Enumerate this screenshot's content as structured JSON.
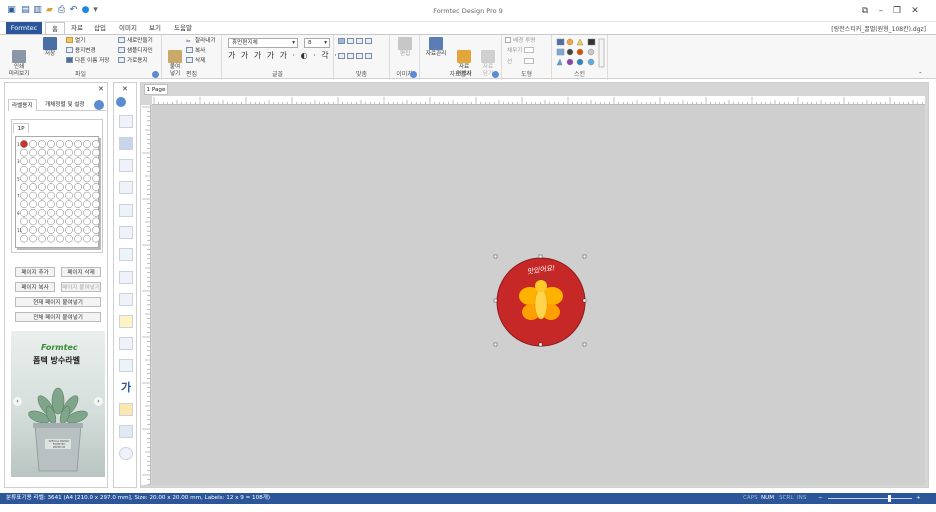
{
  "window": {
    "title": "Formtec Design Pro 9",
    "document_name": "[링전스티커_꿀벌(원형_108칸).dgz]"
  },
  "menu": {
    "file": "Formtec",
    "tabs": [
      "홈",
      "자료",
      "삽입",
      "이미지",
      "보기",
      "도움말"
    ]
  },
  "ribbon": {
    "file_group": {
      "print_preview": "인쇄\n미리보기",
      "save": "저장",
      "open": "열기",
      "change_paper": "용지변경",
      "save_as": "다른 이름 저장",
      "new": "새로만들기",
      "sample_design": "샘플디자인",
      "horizontal_paper": "가로용지",
      "label": "파일"
    },
    "edit_group": {
      "paste": "붙여\n넣기",
      "cut": "잘라내기",
      "copy": "복사",
      "delete": "삭제",
      "label": "편집"
    },
    "font_group": {
      "font_name": "휴먼편지체",
      "font_size": "8",
      "label": "글꼴"
    },
    "align_group": {
      "label": "맞춤"
    },
    "image_group": {
      "edit": "편집",
      "label": "이미지"
    },
    "data_group": {
      "manage": "자료관리",
      "wizard": "자료\n마법사",
      "close": "자료\n닫기",
      "label": "자료관리"
    },
    "shape_group": {
      "background": "배경 투명",
      "fill": "채우기",
      "line": "선",
      "label": "도형"
    },
    "skin_group": {
      "label": "스킨"
    }
  },
  "left_panel": {
    "tabs": [
      "라벨용지",
      "개체정렬 및 설정"
    ],
    "page_tab": "1P",
    "row_numbers": [
      "1",
      "2",
      "3",
      "4",
      "5",
      "6",
      "7",
      "8",
      "9",
      "10",
      "11",
      "12"
    ],
    "buttons": {
      "add_page": "페이지 추가",
      "delete_page": "페이지 삭제",
      "copy_page": "페이지 복사",
      "paste_page": "페이지 붙여넣기",
      "paste_current": "현재 페이지 붙여넣기",
      "paste_all": "전체 페이지 붙여넣기"
    },
    "ad": {
      "brand": "Formtec",
      "headline": "폼텍 방수라벨",
      "pot_text": "SPECIAL BRAND\nFORMTEC\nPREMIUM"
    }
  },
  "canvas": {
    "page_tab": "1 Page",
    "sticker": {
      "text": "맛있어요!",
      "circle_color": "#c62828",
      "bee_color": "#ffb300"
    }
  },
  "status_bar": {
    "info": "분류표기용 라벨: 3641 (A4 [210.0 x 297.0 mm], Size: 20.00 x 20.00 mm, Labels: 12 x 9 = 108개)",
    "caps": "CAPS",
    "num": "NUM",
    "scrl": "SCRL",
    "ins": "INS"
  },
  "colors": {
    "accent": "#2b579a",
    "canvas": "#d6d6d6"
  }
}
